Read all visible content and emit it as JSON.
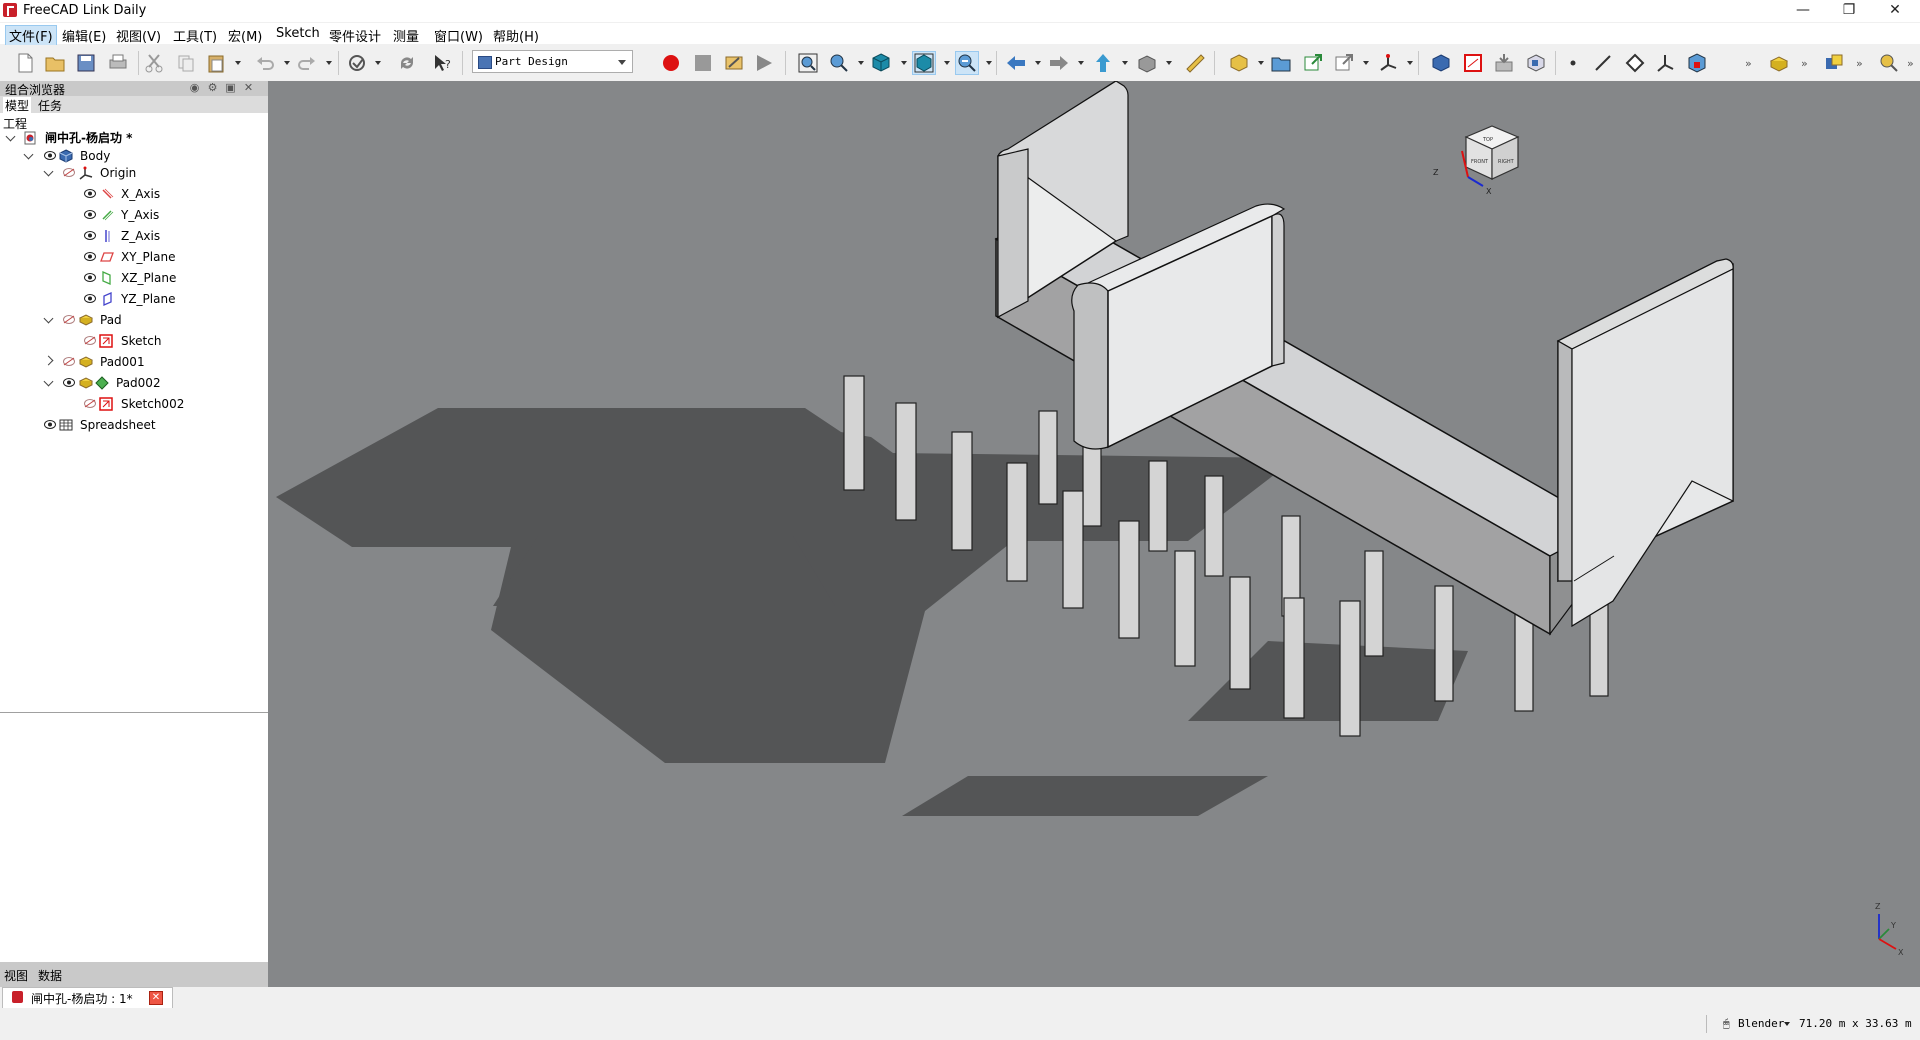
{
  "window": {
    "title": "FreeCAD Link Daily",
    "minimize": "—",
    "restore": "❐",
    "close": "✕"
  },
  "menu": [
    "文件(F)",
    "编辑(E)",
    "视图(V)",
    "工具(T)",
    "宏(M)",
    "Sketch",
    "零件设计",
    "测量",
    "窗口(W)",
    "帮助(H)"
  ],
  "toolbar": {
    "workbench": "Part Design"
  },
  "combo_view": {
    "title": "组合浏览器",
    "tabs": [
      "模型",
      "任务"
    ],
    "tree_heading": "工程",
    "document": "闸中孔-杨启功 *",
    "nodes": {
      "body": "Body",
      "origin": "Origin",
      "x_axis": "X_Axis",
      "y_axis": "Y_Axis",
      "z_axis": "Z_Axis",
      "xy_plane": "XY_Plane",
      "xz_plane": "XZ_Plane",
      "yz_plane": "YZ_Plane",
      "pad": "Pad",
      "sketch": "Sketch",
      "pad001": "Pad001",
      "pad002": "Pad002",
      "sketch002": "Sketch002",
      "spreadsheet": "Spreadsheet"
    },
    "bottom_tabs": [
      "视图",
      "数据"
    ]
  },
  "navcube": {
    "z_label": "Z",
    "x_label": "X",
    "top": "TOP",
    "front": "FRONT",
    "right": "RIGHT"
  },
  "axis_triad": {
    "z": "Z",
    "y": "Y",
    "x": "X"
  },
  "doc_tab": {
    "label": "闸中孔-杨启功 : 1*"
  },
  "status": {
    "nav_style": "Blender",
    "dimensions": "71.20 m x 33.63 m"
  }
}
